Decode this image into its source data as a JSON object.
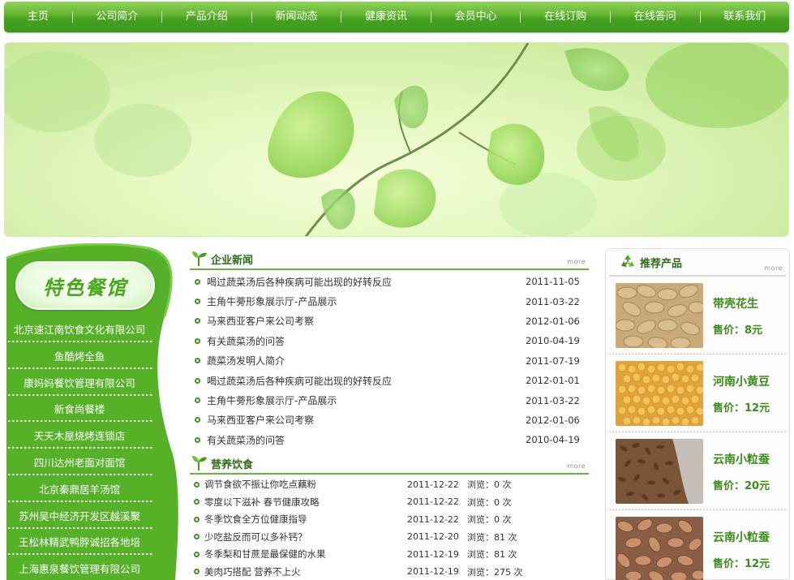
{
  "nav": {
    "items": [
      "主页",
      "公司简介",
      "产品介绍",
      "新闻动态",
      "健康资讯",
      "会员中心",
      "在线订购",
      "在线答问",
      "联系我们"
    ]
  },
  "sidebar": {
    "logo_text": "特色餐馆",
    "items": [
      "北京速江南饮食文化有限公司",
      "鱼酷烤全鱼",
      "康妈妈餐饮管理有限公司",
      "新食尚餐楼",
      "天天木屋烧烤连锁店",
      "四川达州老面对面馆",
      "北京秦鼎居羊汤馆",
      "苏州吴中经济开发区越溪聚",
      "王松林精武鸭脖诚招各地培",
      "上海惠泉餐饮管理有限公司"
    ]
  },
  "news": {
    "title": "企业新闻",
    "more": "more",
    "items": [
      {
        "title": "喝过蔬菜汤后各种疾病可能出现的好转反应",
        "date": "2011-11-05"
      },
      {
        "title": "主角牛蒡形象展示厅-产品展示",
        "date": "2011-03-22"
      },
      {
        "title": "马来西亚客户来公司考察",
        "date": "2012-01-06"
      },
      {
        "title": "有关蔬菜汤的问答",
        "date": "2010-04-19"
      },
      {
        "title": "蔬菜汤发明人简介",
        "date": "2011-07-19"
      },
      {
        "title": "喝过蔬菜汤后各种疾病可能出现的好转反应",
        "date": "2012-01-01"
      },
      {
        "title": "主角牛蒡形象展示厅-产品展示",
        "date": "2011-03-22"
      },
      {
        "title": "马来西亚客户来公司考察",
        "date": "2012-01-06"
      },
      {
        "title": "有关蔬菜汤的问答",
        "date": "2010-04-19"
      }
    ]
  },
  "diet": {
    "title": "营养饮食",
    "more": "more",
    "items": [
      {
        "title": "调节食欲不振让你吃点藕粉",
        "date": "2011-12-22",
        "views": "浏览：0 次"
      },
      {
        "title": "零度以下滋补  春节健康攻略",
        "date": "2011-12-22",
        "views": "浏览：0 次"
      },
      {
        "title": "冬季饮食全方位健康指导",
        "date": "2011-12-22",
        "views": "浏览：0 次"
      },
      {
        "title": "少吃盐反而可以多补钙？",
        "date": "2011-12-20",
        "views": "浏览：81 次"
      },
      {
        "title": "冬季梨和甘蔗是最保健的水果",
        "date": "2011-12-19",
        "views": "浏览：81 次"
      },
      {
        "title": "美肉巧搭配 营养不上火",
        "date": "2011-12-19",
        "views": "浏览：275 次"
      }
    ]
  },
  "products": {
    "title": "推荐产品",
    "more": "more",
    "items": [
      {
        "name": "带壳花生",
        "price": "售价：8元",
        "icon": "peanut-image"
      },
      {
        "name": "河南小黄豆",
        "price": "售价：12元",
        "icon": "soybean-image"
      },
      {
        "name": "云南小粒蚕",
        "price": "售价：20元",
        "icon": "seed-image"
      },
      {
        "name": "云南小粒蚕",
        "price": "售价：12元",
        "icon": "bean-image"
      }
    ]
  },
  "colors": {
    "nav_green": "#47a021",
    "sidebar_green": "#56b028",
    "title_green": "#2f6a17",
    "product_green": "#3a8c16"
  }
}
